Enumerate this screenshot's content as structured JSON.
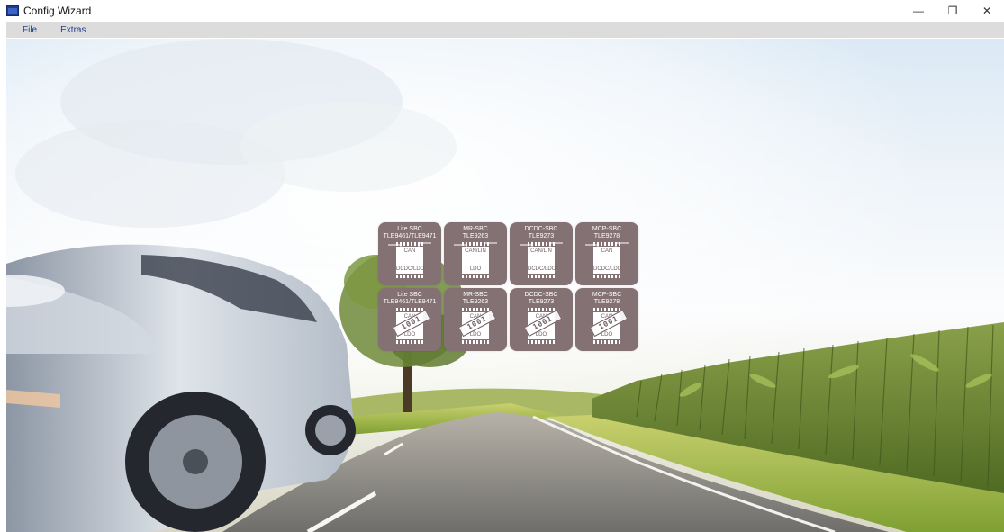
{
  "window": {
    "title": "Config Wizard",
    "minimize_glyph": "—",
    "restore_glyph": "❐",
    "close_glyph": "✕"
  },
  "menu": [
    {
      "label": "File"
    },
    {
      "label": "Extras"
    }
  ],
  "colors": {
    "tile_bg": "#847173",
    "menu_text": "#1f3e8c",
    "menubar_bg": "#dcdcdc"
  },
  "tiles": [
    {
      "name": "Lite SBC",
      "part": "TLE9461/TLE9471",
      "chip_top": "CAN",
      "chip_bottom": "DCDC/LDO",
      "variant": "config",
      "icon": "chip-icon"
    },
    {
      "name": "MR-SBC",
      "part": "TLE9263",
      "chip_top": "CAN/LIN",
      "chip_bottom": "LDO",
      "variant": "config",
      "icon": "chip-icon"
    },
    {
      "name": "DCDC-SBC",
      "part": "TLE9273",
      "chip_top": "CAN/LIN",
      "chip_bottom": "DCDC/LDO",
      "variant": "config",
      "icon": "chip-icon"
    },
    {
      "name": "MCP-SBC",
      "part": "TLE9278",
      "chip_top": "CAN",
      "chip_bottom": "DCDC/LDO",
      "variant": "config",
      "icon": "chip-icon"
    },
    {
      "name": "Lite SBC",
      "part": "TLE9461/TLE9471",
      "chip_top": "CAN",
      "chip_bottom": "LDO",
      "variant": "binary",
      "binary": "1001",
      "icon": "chip-binary-icon"
    },
    {
      "name": "MR-SBC",
      "part": "TLE9263",
      "chip_top": "CAN",
      "chip_bottom": "LDO",
      "variant": "binary",
      "binary": "1001",
      "icon": "chip-binary-icon"
    },
    {
      "name": "DCDC-SBC",
      "part": "TLE9273",
      "chip_top": "CAN",
      "chip_bottom": "LDO",
      "variant": "binary",
      "binary": "1001",
      "icon": "chip-binary-icon"
    },
    {
      "name": "MCP-SBC",
      "part": "TLE9278",
      "chip_top": "CAN",
      "chip_bottom": "LDO",
      "variant": "binary",
      "binary": "1001",
      "icon": "chip-binary-icon"
    }
  ]
}
